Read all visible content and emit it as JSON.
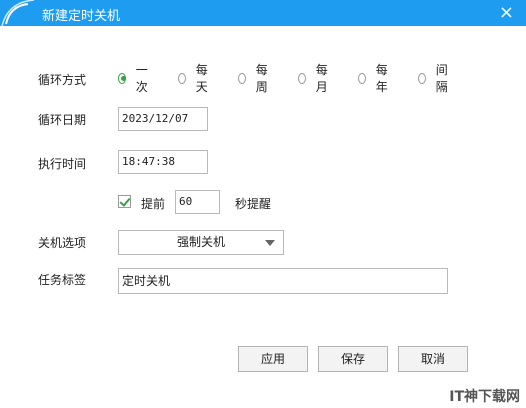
{
  "window": {
    "title": "新建定时关机",
    "close_icon": "×"
  },
  "labels": {
    "repeat_mode": "循环方式",
    "repeat_date": "循环日期",
    "exec_time": "执行时间",
    "shutdown_option": "关机选项",
    "task_label": "任务标签"
  },
  "repeat_options": [
    {
      "label": "一次",
      "selected": true
    },
    {
      "label": "每天",
      "selected": false
    },
    {
      "label": "每周",
      "selected": false
    },
    {
      "label": "每月",
      "selected": false
    },
    {
      "label": "每年",
      "selected": false
    },
    {
      "label": "间隔",
      "selected": false
    }
  ],
  "inputs": {
    "date": "2023/12/07",
    "time": "18:47:38",
    "advance_seconds": "60",
    "task_label": "定时关机"
  },
  "reminder": {
    "prefix": "提前",
    "suffix": "秒提醒",
    "checked": true
  },
  "shutdown_select": {
    "value": "强制关机"
  },
  "buttons": {
    "apply": "应用",
    "save": "保存",
    "cancel": "取消"
  },
  "watermark": "IT神下载网",
  "colors": {
    "titlebar": "#1e9df0",
    "accent": "#3aa04a"
  }
}
